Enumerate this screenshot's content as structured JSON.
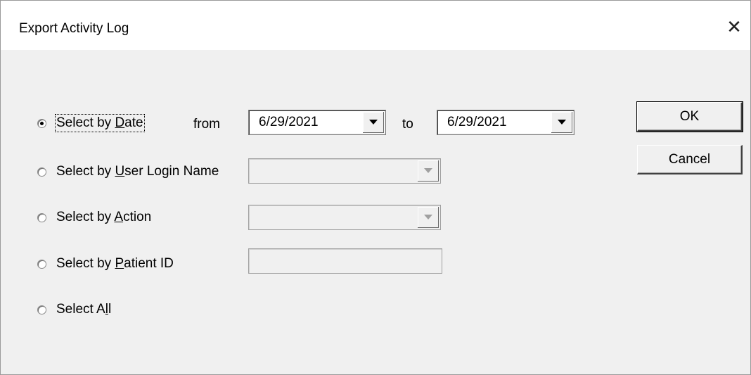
{
  "window": {
    "title": "Export Activity Log",
    "close_glyph": "✕"
  },
  "options": [
    {
      "label_pre": "Select by ",
      "label_key": "D",
      "label_post": "ate",
      "checked": true
    },
    {
      "label_pre": "Select by ",
      "label_key": "U",
      "label_post": "ser Login Name",
      "checked": false
    },
    {
      "label_pre": "Select by ",
      "label_key": "A",
      "label_post": "ction",
      "checked": false
    },
    {
      "label_pre": "Select by ",
      "label_key": "P",
      "label_post": "atient ID",
      "checked": false
    },
    {
      "label_pre": "Select A",
      "label_key": "l",
      "label_post": "l",
      "checked": false
    }
  ],
  "date_range": {
    "from_label": "from",
    "to_label": "to",
    "from_value": "6/29/2021",
    "to_value": "6/29/2021"
  },
  "user_login_name": {
    "value": "",
    "enabled": false
  },
  "action": {
    "value": "",
    "enabled": false
  },
  "patient_id": {
    "value": "",
    "enabled": false
  },
  "buttons": {
    "ok": "OK",
    "cancel": "Cancel"
  }
}
